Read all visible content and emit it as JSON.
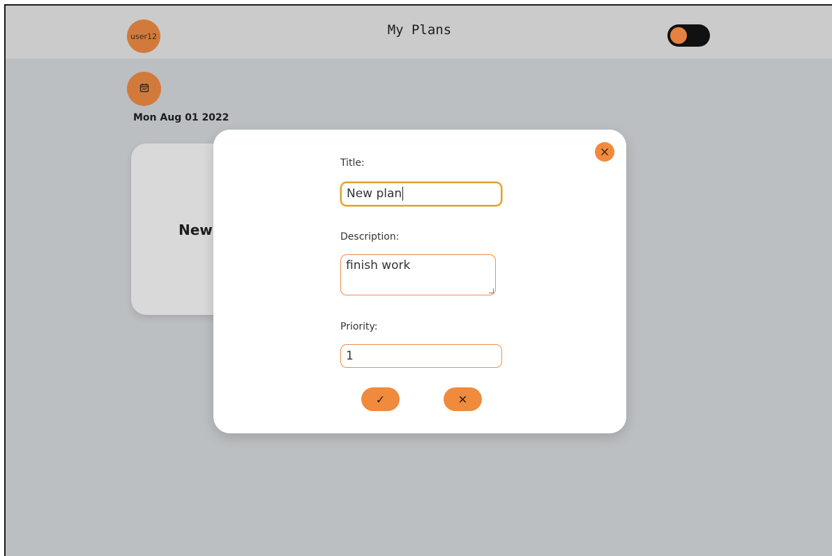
{
  "header": {
    "username": "user12",
    "title": "My Plans"
  },
  "main": {
    "date": "Mon Aug 01 2022",
    "card_title": "New"
  },
  "modal": {
    "title_label": "Title:",
    "title_value": "New plan",
    "description_label": "Description:",
    "description_value": "finish work",
    "priority_label": "Priority:",
    "priority_value": "1",
    "confirm_label": "✓",
    "cancel_label": "✕"
  },
  "icons": {
    "calendar": "calendar-icon",
    "close": "close-icon",
    "theme_toggle": "toggle-switch"
  },
  "colors": {
    "accent": "#f08a3c",
    "avatar": "#d27a3b",
    "background": "#bcbfc2",
    "topbar": "#cbcbcb"
  }
}
